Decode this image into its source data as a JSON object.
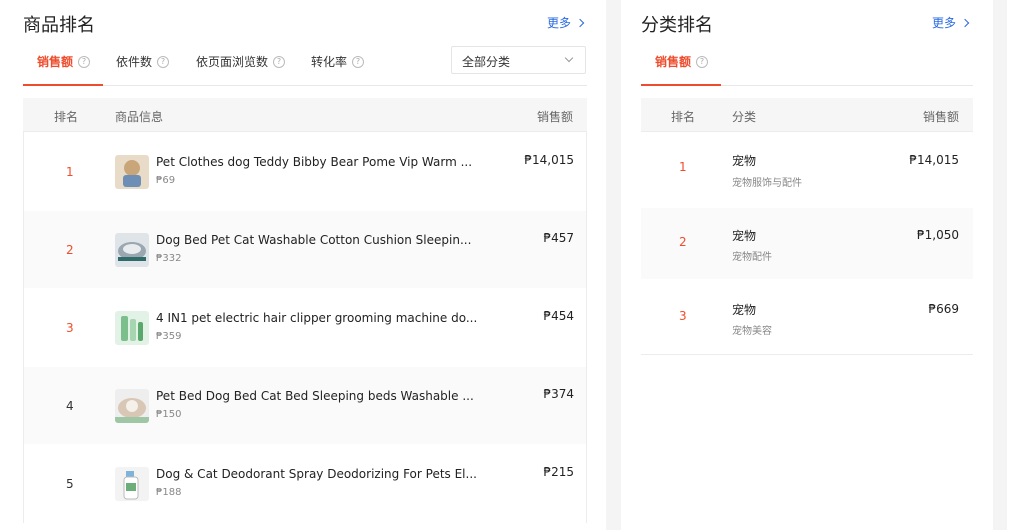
{
  "product_ranking": {
    "title": "商品排名",
    "more": "更多",
    "tabs": [
      {
        "label": "销售额"
      },
      {
        "label": "依件数"
      },
      {
        "label": "依页面浏览数"
      },
      {
        "label": "转化率"
      }
    ],
    "category_filter": "全部分类",
    "columns": {
      "rank": "排名",
      "info": "商品信息",
      "sales": "销售额"
    },
    "rows": [
      {
        "rank": "1",
        "name": "Pet Clothes dog Teddy Bibby Bear Pome Vip Warm ...",
        "price": "₱69",
        "sales": "₱14,015"
      },
      {
        "rank": "2",
        "name": "Dog Bed Pet Cat Washable Cotton Cushion Sleepin...",
        "price": "₱332",
        "sales": "₱457"
      },
      {
        "rank": "3",
        "name": "4 IN1 pet electric hair clipper grooming machine do...",
        "price": "₱359",
        "sales": "₱454"
      },
      {
        "rank": "4",
        "name": "Pet Bed Dog Bed Cat Bed Sleeping beds Washable ...",
        "price": "₱150",
        "sales": "₱374"
      },
      {
        "rank": "5",
        "name": "Dog & Cat Deodorant Spray Deodorizing For Pets El...",
        "price": "₱188",
        "sales": "₱215"
      }
    ]
  },
  "category_ranking": {
    "title": "分类排名",
    "more": "更多",
    "tab": "销售额",
    "columns": {
      "rank": "排名",
      "category": "分类",
      "sales": "销售额"
    },
    "rows": [
      {
        "rank": "1",
        "category": "宠物",
        "sub": "宠物服饰与配件",
        "sales": "₱14,015"
      },
      {
        "rank": "2",
        "category": "宠物",
        "sub": "宠物配件",
        "sales": "₱1,050"
      },
      {
        "rank": "3",
        "category": "宠物",
        "sub": "宠物美容",
        "sales": "₱669"
      }
    ]
  },
  "colors": {
    "accent": "#ee4d2d",
    "link": "#2a6ae2"
  }
}
